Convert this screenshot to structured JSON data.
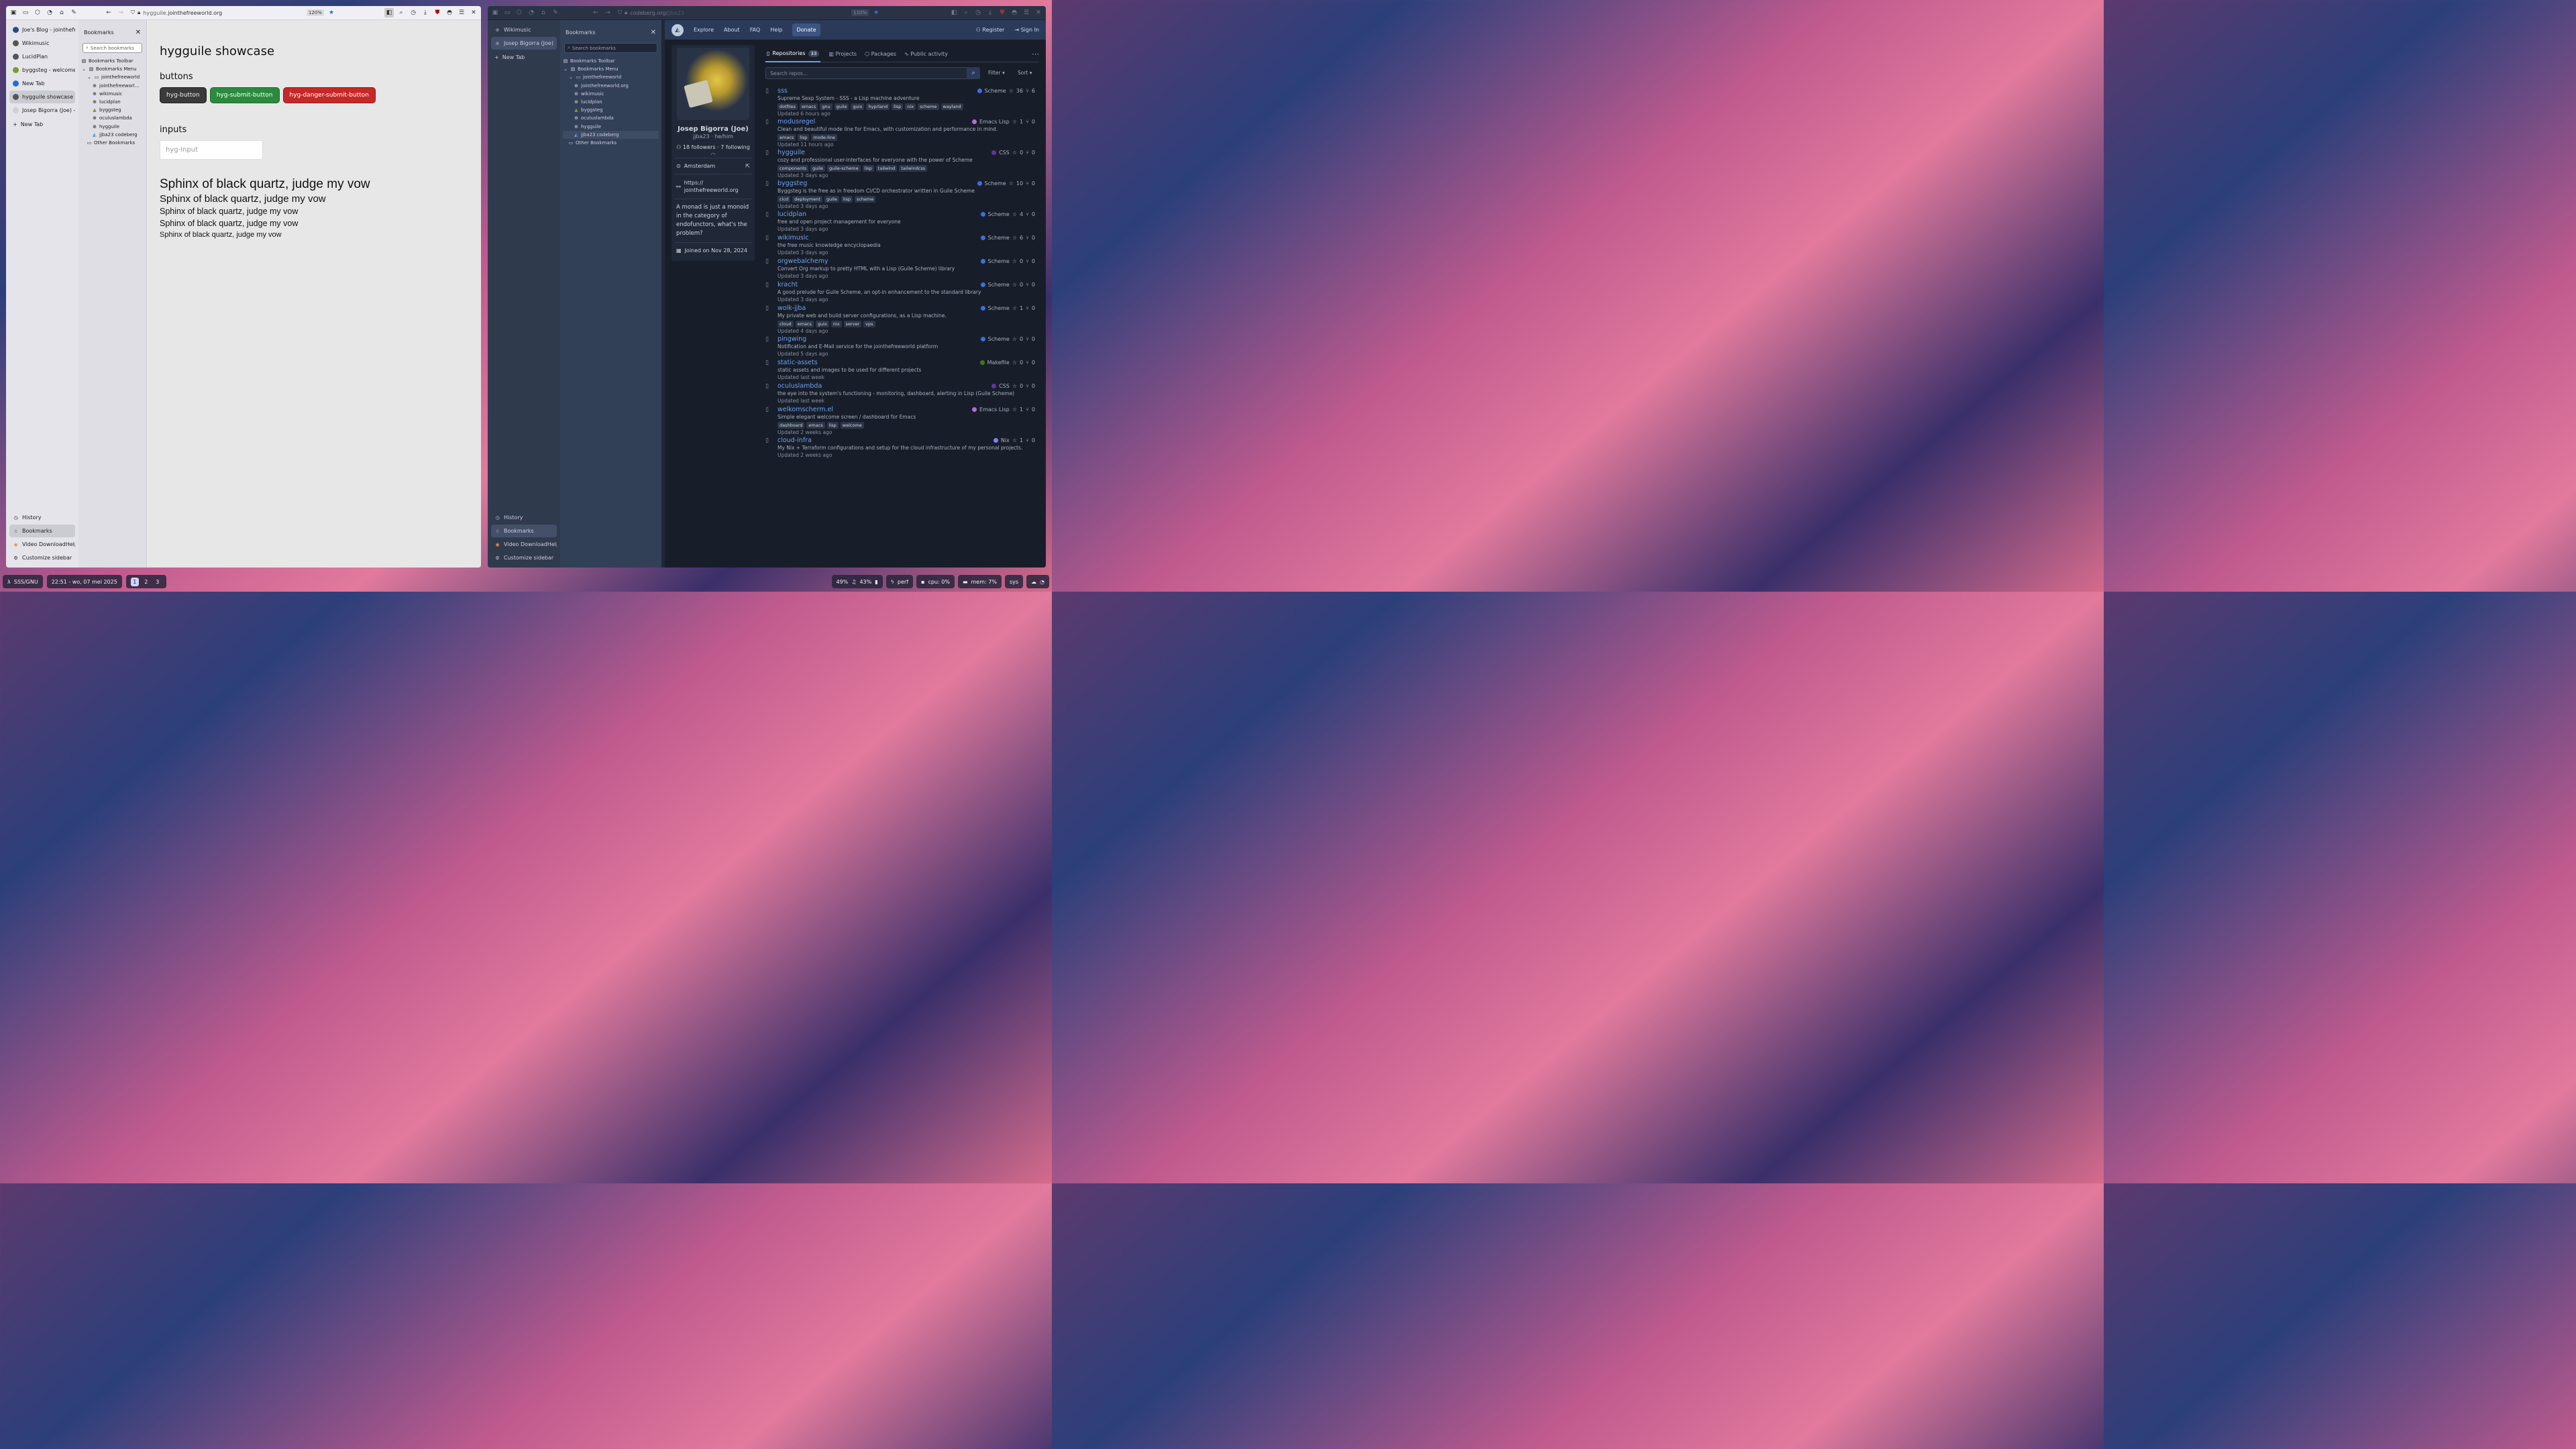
{
  "left_window": {
    "url_prefix": "hygguile.",
    "url_domain": "jointhefreeworld.org",
    "zoom": "120%",
    "tabs": [
      {
        "label": "Joe's Blog - jointhefree",
        "fav": "#2b4c7e"
      },
      {
        "label": "Wikimusic",
        "fav": "#555"
      },
      {
        "label": "LucidPlan",
        "fav": "#555"
      },
      {
        "label": "byggsteg - welcome to",
        "fav": "#7a9c2b"
      },
      {
        "label": "New Tab",
        "fav": "#1f6fd6"
      },
      {
        "label": "hygguile showcase",
        "fav": "#555",
        "selected": true
      },
      {
        "label": "Josep Bigorra (Joe) - C",
        "fav": "#cfcfcf"
      }
    ],
    "new_tab": "New Tab",
    "bottom": [
      "History",
      "Bookmarks",
      "Video DownloadHelper",
      "Customize sidebar"
    ],
    "bookmarks": {
      "title": "Bookmarks",
      "search": "Search bookmarks",
      "toolbar": "Bookmarks Toolbar",
      "menu": "Bookmarks Menu",
      "folder": "jointhefreeworld",
      "items": [
        "jointhefreeworl...",
        "wikimusic",
        "lucidplan",
        "byggsteg",
        "oculuslambda",
        "hygguile"
      ],
      "extra": "jjba23 codeberg",
      "other": "Other Bookmarks"
    },
    "page": {
      "title": "hygguile showcase",
      "h_buttons": "buttons",
      "btn1": "hyg-button",
      "btn2": "hyg-submit-button",
      "btn3": "hyg-danger-submit-button",
      "h_inputs": "inputs",
      "input_ph": "hyg-input",
      "pangram": "Sphinx of black quartz, judge my vow"
    }
  },
  "right_window": {
    "url_prefix": "codeberg.org/",
    "url_path": "jjba23",
    "zoom": "110%",
    "tabs": [
      {
        "label": "Wikimusic"
      },
      {
        "label": "Josep Bigorra (Joe)",
        "selected": true
      }
    ],
    "new_tab": "New Tab",
    "bottom": [
      "History",
      "Bookmarks",
      "Video DownloadHelper",
      "Customize sidebar"
    ],
    "bookmarks": {
      "title": "Bookmarks",
      "search": "Search bookmarks",
      "toolbar": "Bookmarks Toolbar",
      "menu": "Bookmarks Menu",
      "folder": "jointhefreeworld",
      "items": [
        "jointhefreeworld.org",
        "wikimusic",
        "lucidplan",
        "byggsteg",
        "oculuslambda",
        "hygguile"
      ],
      "extra": "jjba23 codeberg",
      "other": "Other Bookmarks"
    },
    "nav": {
      "explore": "Explore",
      "about": "About",
      "faq": "FAQ",
      "help": "Help",
      "donate": "Donate",
      "register": "Register",
      "signin": "Sign In"
    },
    "profile": {
      "name": "Josep Bigorra (Joe)",
      "user": "jjba23 · he/him",
      "followers": "18 followers · 7 following",
      "location": "Amsterdam",
      "website_1": "https://",
      "website_2": "jointhefreeworld.org",
      "bio": "A monad is just a monoid in the category of endofunctors, what's the problem?",
      "joined": "Joined on Nov 28, 2024"
    },
    "tabs_row": {
      "repos": "Repositories",
      "repos_count": "33",
      "projects": "Projects",
      "packages": "Packages",
      "activity": "Public activity"
    },
    "search_ph": "Search repos...",
    "filter": "Filter",
    "sort": "Sort",
    "repos": [
      {
        "name": "sss",
        "desc": "Supreme Sexp System - SSS - a Lisp machine adventure",
        "tags": [
          "dotfiles",
          "emacs",
          "gnu",
          "guile",
          "guix",
          "hyprland",
          "lisp",
          "nix",
          "scheme",
          "wayland"
        ],
        "updated": "Updated 6 hours ago",
        "lang": "Scheme",
        "color": "#3b6ee0",
        "stars": "36",
        "forks": "6"
      },
      {
        "name": "modusregel",
        "desc": "Clean and beautiful mode line for Emacs, with customization and performance in mind.",
        "tags": [
          "emacs",
          "lisp",
          "mode-line"
        ],
        "updated": "Updated 11 hours ago",
        "lang": "Emacs Lisp",
        "color": "#c065db",
        "stars": "1",
        "forks": "0"
      },
      {
        "name": "hygguile",
        "desc": "cozy and professional user-interfaces for everyone with the power of Scheme",
        "tags": [
          "components",
          "guile",
          "guile-scheme",
          "lisp",
          "tailwind",
          "tailwindcss"
        ],
        "updated": "Updated 3 days ago",
        "lang": "CSS",
        "color": "#663399",
        "stars": "0",
        "forks": "0"
      },
      {
        "name": "byggsteg",
        "desc": "Byggsteg is the free as in freedom CI/CD orchestrator written in Guile Scheme",
        "tags": [
          "cicd",
          "deployment",
          "guile",
          "lisp",
          "scheme"
        ],
        "updated": "Updated 3 days ago",
        "lang": "Scheme",
        "color": "#3b6ee0",
        "stars": "10",
        "forks": "0"
      },
      {
        "name": "lucidplan",
        "desc": "free and open project management for everyone",
        "tags": [],
        "updated": "Updated 3 days ago",
        "lang": "Scheme",
        "color": "#3b6ee0",
        "stars": "4",
        "forks": "0"
      },
      {
        "name": "wikimusic",
        "desc": "the free music knowledge encyclopaedia",
        "tags": [],
        "updated": "Updated 3 days ago",
        "lang": "Scheme",
        "color": "#3b6ee0",
        "stars": "6",
        "forks": "0"
      },
      {
        "name": "orgwebalchemy",
        "desc": "Convert Org markup to pretty HTML with a Lisp (Guile Scheme) library",
        "tags": [],
        "updated": "Updated 3 days ago",
        "lang": "Scheme",
        "color": "#3b6ee0",
        "stars": "0",
        "forks": "0"
      },
      {
        "name": "kracht",
        "desc": "A good prelude for Guile Scheme, an opt-in enhancement to the standard library",
        "tags": [],
        "updated": "Updated 3 days ago",
        "lang": "Scheme",
        "color": "#3b6ee0",
        "stars": "0",
        "forks": "0"
      },
      {
        "name": "wolk-jjba",
        "desc": "My private web and build server configurations, as a Lisp machine.",
        "tags": [
          "cloud",
          "emacs",
          "guix",
          "nix",
          "server",
          "vps"
        ],
        "updated": "Updated 4 days ago",
        "lang": "Scheme",
        "color": "#3b6ee0",
        "stars": "1",
        "forks": "0"
      },
      {
        "name": "pingwing",
        "desc": "Notification and E-Mail service for the jointhefreeworld platform",
        "tags": [],
        "updated": "Updated 5 days ago",
        "lang": "Scheme",
        "color": "#3b6ee0",
        "stars": "0",
        "forks": "0"
      },
      {
        "name": "static-assets",
        "desc": "static assets and images to be used for different projects",
        "tags": [],
        "updated": "Updated last week",
        "lang": "Makefile",
        "color": "#427819",
        "stars": "0",
        "forks": "0"
      },
      {
        "name": "oculuslambda",
        "desc": "the eye into the system's functioning - monitoring, dashboard, alerting in Lisp (Guile Scheme)",
        "tags": [],
        "updated": "Updated last week",
        "lang": "CSS",
        "color": "#663399",
        "stars": "0",
        "forks": "0"
      },
      {
        "name": "welkomscherm.el",
        "desc": "Simple elegant welcome screen / dashboard for Emacs",
        "tags": [
          "dashboard",
          "emacs",
          "lisp",
          "welcome"
        ],
        "updated": "Updated 2 weeks ago",
        "lang": "Emacs Lisp",
        "color": "#c065db",
        "stars": "1",
        "forks": "0"
      },
      {
        "name": "cloud-infra",
        "desc": "My Nix + Terraform configurations and setup for the cloud infrastructure of my personal projects.",
        "tags": [],
        "updated": "Updated 2 weeks ago",
        "lang": "Nix",
        "color": "#7e7eff",
        "stars": "1",
        "forks": "0"
      }
    ]
  },
  "taskbar": {
    "os": "SSS/GNU",
    "clock": "22:51 - wo, 07 mei 2025",
    "workspaces": [
      "1",
      "2",
      "3"
    ],
    "battery": "49%",
    "volume": "43%",
    "perf": "perf",
    "cpu": "cpu: 0%",
    "mem": "mem: 7%",
    "sys": "sys"
  }
}
